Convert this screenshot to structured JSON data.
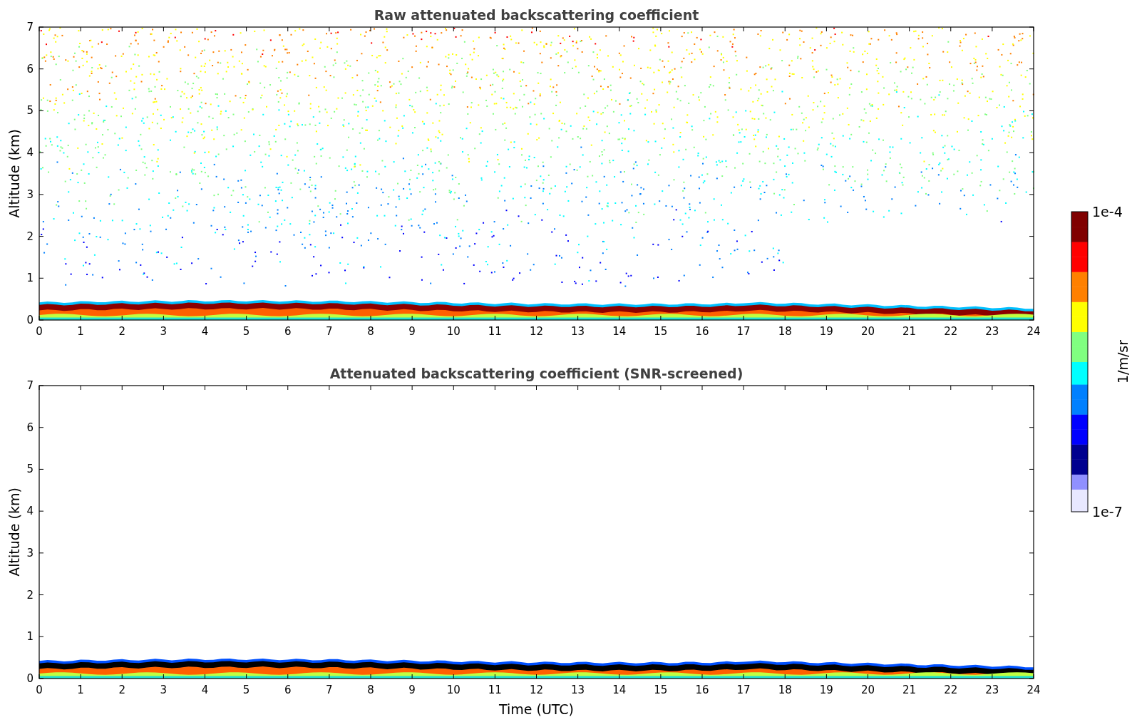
{
  "panels": [
    {
      "kind": "raw",
      "title": "Raw attenuated backscattering coefficient",
      "ylabel": "Altitude (km)",
      "yticks": [
        "7",
        "6",
        "5",
        "4",
        "3",
        "2",
        "1",
        "0"
      ],
      "xticks": [
        "0",
        "1",
        "2",
        "3",
        "4",
        "5",
        "6",
        "7",
        "8",
        "9",
        "10",
        "11",
        "12",
        "13",
        "14",
        "15",
        "16",
        "17",
        "18",
        "19",
        "20",
        "21",
        "22",
        "23",
        "24"
      ]
    },
    {
      "kind": "screened",
      "title": "Attenuated backscattering coefficient (SNR-screened)",
      "ylabel": "Altitude (km)",
      "yticks": [
        "7",
        "6",
        "5",
        "4",
        "3",
        "2",
        "1",
        "0"
      ],
      "xticks": [
        "0",
        "1",
        "2",
        "3",
        "4",
        "5",
        "6",
        "7",
        "8",
        "9",
        "10",
        "11",
        "12",
        "13",
        "14",
        "15",
        "16",
        "17",
        "18",
        "19",
        "20",
        "21",
        "22",
        "23",
        "24"
      ],
      "xlabel": "Time (UTC)"
    }
  ],
  "colorbar": {
    "max_label": "1e-4",
    "min_label": "1e-7",
    "label": "1/m/sr"
  }
}
